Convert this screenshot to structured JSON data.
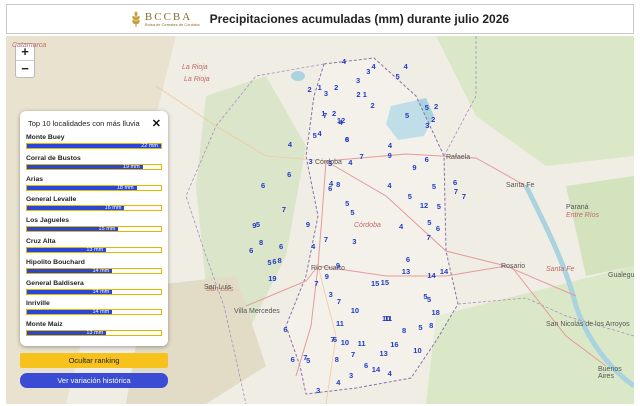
{
  "header": {
    "logo_name": "BCCBA",
    "logo_sub": "Bolsa de Cereales de Córdoba",
    "title": "Precipitaciones acumuladas (mm) durante julio 2026"
  },
  "zoom": {
    "in_label": "+",
    "out_label": "−"
  },
  "colors": {
    "accent": "#2b45d6",
    "rank_button": "#f6c21b",
    "history_button": "#3a4cd3",
    "bar_border": "#e0b800"
  },
  "ranking": {
    "title": "Top 10 localidades con más lluvia",
    "close_label": "✕",
    "max_value": 22,
    "items": [
      {
        "name": "Monte Buey",
        "value": 22,
        "label": "22 mm"
      },
      {
        "name": "Corral de Bustos",
        "value": 19,
        "label": "19 mm"
      },
      {
        "name": "Arias",
        "value": 18,
        "label": "18 mm"
      },
      {
        "name": "General Levalle",
        "value": 16,
        "label": "16 mm"
      },
      {
        "name": "Los Jagueles",
        "value": 15,
        "label": "15 mm"
      },
      {
        "name": "Cruz Alta",
        "value": 13,
        "label": "13 mm"
      },
      {
        "name": "Hipolito Bouchard",
        "value": 14,
        "label": "14 mm"
      },
      {
        "name": "General Baldisera",
        "value": 14,
        "label": "14 mm"
      },
      {
        "name": "Inriville",
        "value": 14,
        "label": "14 mm"
      },
      {
        "name": "Monte Maiz",
        "value": 13,
        "label": "13 mm"
      }
    ]
  },
  "buttons": {
    "hide_ranking": "Ocultar ranking",
    "history": "Ver variación histórica"
  },
  "map": {
    "region_labels": [
      "Catamarca",
      "La Rioja",
      "La Rioja",
      "San Luis",
      "Santa Fe",
      "Entre Ríos",
      "Córdoba"
    ],
    "city_labels": [
      "Córdoba",
      "Río Cuarto",
      "Rafaela",
      "Santa Fe",
      "Rosario",
      "San Luis",
      "Villa Mercedes",
      "Paraná",
      "San Nicolás de los Arroyos",
      "Gualeguaychú",
      "Buenos Aires"
    ],
    "values": [
      "4",
      "4",
      "3",
      "4",
      "3",
      "5",
      "1",
      "2",
      "3",
      "1",
      "2",
      "5",
      "2",
      "1",
      "2",
      "2",
      "2",
      "7",
      "12",
      "5",
      "4",
      "2",
      "3",
      "4",
      "6",
      "4",
      "5",
      "4",
      "8",
      "9",
      "3",
      "7",
      "6",
      "4",
      "3",
      "6",
      "9",
      "6",
      "5",
      "4",
      "6",
      "4",
      "8",
      "5",
      "7",
      "6",
      "5",
      "7",
      "5",
      "5",
      "12",
      "9",
      "7",
      "4",
      "6",
      "5",
      "5",
      "9",
      "7",
      "6",
      "8",
      "3",
      "7",
      "4",
      "8",
      "6",
      "5",
      "6",
      "9",
      "6",
      "13",
      "14",
      "15",
      "9",
      "14",
      "19",
      "7",
      "15",
      "3",
      "5",
      "7",
      "5",
      "10",
      "10",
      "18",
      "11",
      "11",
      "5",
      "8",
      "8",
      "6",
      "11",
      "6",
      "16",
      "10",
      "13",
      "7",
      "10",
      "7",
      "5",
      "7",
      "6",
      "3",
      "8",
      "6",
      "14",
      "4",
      "4",
      "3"
    ]
  }
}
